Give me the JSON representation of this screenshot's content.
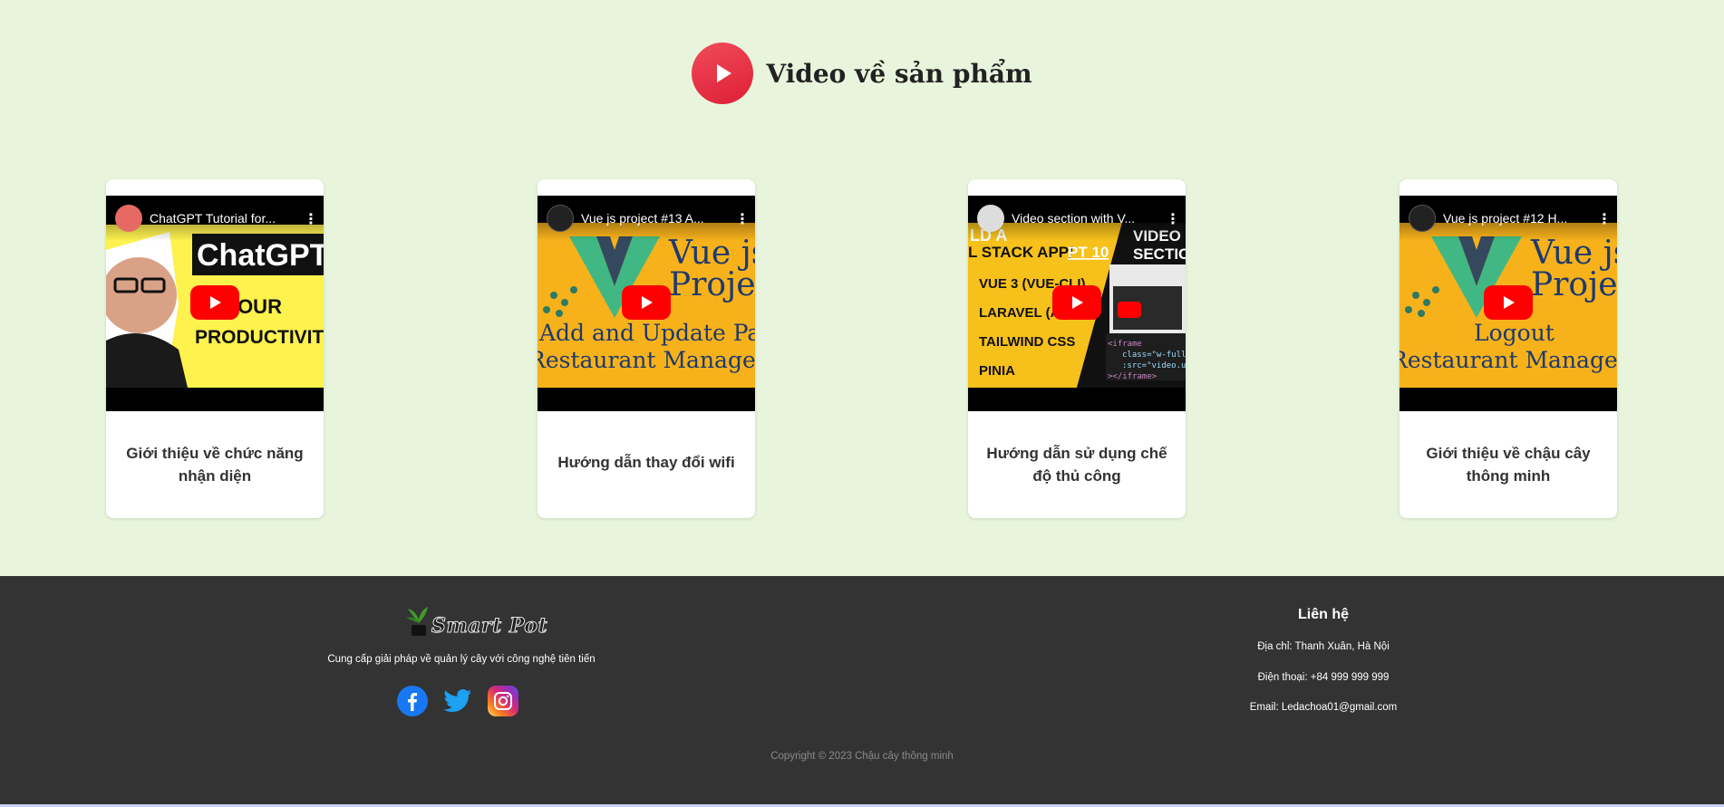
{
  "section": {
    "title": "Video về sản phẩm"
  },
  "videos": [
    {
      "title": "ChatGPT Tutorial for...",
      "label": "Giới thiệu về chức năng nhận diện"
    },
    {
      "title": "Vue js project #13 A...",
      "label": "Hướng dẫn thay đổi wifi"
    },
    {
      "title": "Video section with V...",
      "label": "Hướng dẫn sử dụng chế độ thủ công"
    },
    {
      "title": "Vue js project #12 H...",
      "label": "Giới thiệu về chậu cây thông minh"
    }
  ],
  "thumbs": {
    "t1": {
      "headline": "ChatGPT",
      "line1": "X YOUR",
      "line2": "PRODUCTIVITY"
    },
    "t2": {
      "brand": "Vue js",
      "brand2": "Project",
      "line1": "Add and Update Page",
      "line2": "Restaurant Management"
    },
    "t3": {
      "corner": "LD A",
      "line0": "L STACK APP/",
      "part": "PT 10",
      "tags": [
        "VUE 3 (VUE-CLI)",
        "LARAVEL (API)",
        "TAILWIND CSS",
        "PINIA"
      ],
      "side1": "VIDEO",
      "side2": "SECTION",
      "code1": "<iframe",
      "code2": "class=\"w-full",
      "code3": ":src=\"video.u",
      "code4": "></iframe>"
    },
    "t4": {
      "brand": "Vue js",
      "brand2": "Project",
      "line1": "Logout",
      "line2": "Restaurant Management"
    }
  },
  "footer": {
    "logo": "Smart Pot",
    "slogan": "Cung cấp giải pháp về quản lý cây với công nghệ tiên tiến",
    "contact_title": "Liên hệ",
    "address": "Địa chỉ: Thanh Xuân, Hà Nội",
    "phone": "Điện thoại: +84 999 999 999",
    "email": "Email: Ledachoa01@gmail.com",
    "copyright": "Copyright © 2023 Chậu cây thông minh"
  },
  "colors": {
    "background": "#e8f5dc",
    "footer": "#333333",
    "accent": "#e8293f",
    "youtube": "#ff0000"
  },
  "icons": {
    "header": "play-circle-icon",
    "socials": [
      "facebook-icon",
      "twitter-icon",
      "instagram-icon"
    ]
  }
}
